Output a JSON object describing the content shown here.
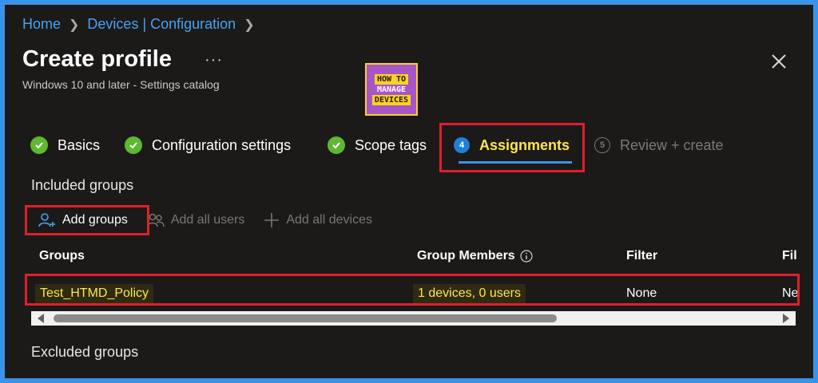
{
  "breadcrumb": {
    "items": [
      "Home",
      "Devices | Configuration"
    ]
  },
  "header": {
    "title": "Create profile",
    "more": "···",
    "subtitle": "Windows 10 and later - Settings catalog"
  },
  "logo": {
    "line1": "HOW TO",
    "line2": "MANAGE",
    "line3": "DEVICES"
  },
  "steps": [
    {
      "label": "Basics",
      "state": "complete"
    },
    {
      "label": "Configuration settings",
      "state": "complete"
    },
    {
      "label": "Scope tags",
      "state": "complete"
    },
    {
      "number": "4",
      "label": "Assignments",
      "state": "active"
    },
    {
      "number": "5",
      "label": "Review + create",
      "state": "disabled"
    }
  ],
  "included": {
    "title": "Included groups"
  },
  "toolbar": {
    "add_groups": "Add groups",
    "add_all_users": "Add all users",
    "add_all_devices": "Add all devices"
  },
  "table": {
    "columns": [
      "Groups",
      "Group Members",
      "Filter",
      "Fil"
    ],
    "rows": [
      {
        "group": "Test_HTMD_Policy",
        "members": "1 devices, 0 users",
        "filter": "None",
        "filter_mode": "Ne"
      }
    ]
  },
  "excluded": {
    "title": "Excluded groups"
  },
  "colors": {
    "accent": "#3b93e8",
    "highlight": "#ffe64d",
    "check": "#5fb832",
    "callout": "#e01f2a"
  }
}
